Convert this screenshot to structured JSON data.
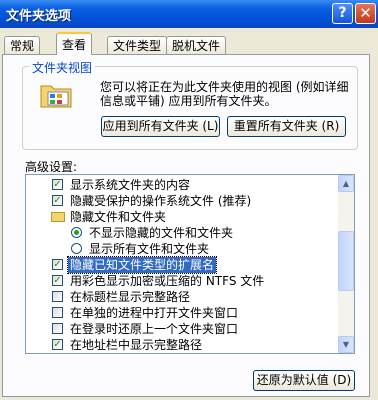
{
  "window": {
    "title": "文件夹选项"
  },
  "titlebar_buttons": {
    "help": "?",
    "close": "✕"
  },
  "tabs": [
    {
      "label": "常规"
    },
    {
      "label": "查看"
    },
    {
      "label": "文件类型"
    },
    {
      "label": "脱机文件"
    }
  ],
  "folder_views": {
    "title": "文件夹视图",
    "description": "您可以将正在为此文件夹使用的视图 (例如详细信息或平铺) 应用到所有文件夹。",
    "apply_all_button": "应用到所有文件夹 (L)",
    "reset_all_button": "重置所有文件夹 (R)"
  },
  "advanced": {
    "label": "高级设置:",
    "items": [
      {
        "type": "checkbox",
        "checked": true,
        "label": "显示系统文件夹的内容"
      },
      {
        "type": "checkbox",
        "checked": true,
        "label": "隐藏受保护的操作系统文件 (推荐)"
      },
      {
        "type": "folder",
        "label": "隐藏文件和文件夹"
      },
      {
        "type": "radio",
        "checked": true,
        "label": "不显示隐藏的文件和文件夹"
      },
      {
        "type": "radio",
        "checked": false,
        "label": "显示所有文件和文件夹"
      },
      {
        "type": "checkbox",
        "checked": true,
        "label": "隐藏已知文件类型的扩展名",
        "selected": true
      },
      {
        "type": "checkbox",
        "checked": true,
        "label": "用彩色显示加密或压缩的 NTFS 文件"
      },
      {
        "type": "checkbox",
        "checked": false,
        "label": "在标题栏显示完整路径"
      },
      {
        "type": "checkbox",
        "checked": false,
        "label": "在单独的进程中打开文件夹窗口"
      },
      {
        "type": "checkbox",
        "checked": false,
        "label": "在登录时还原上一个文件夹窗口"
      },
      {
        "type": "checkbox",
        "checked": true,
        "label": "在地址栏中显示完整路径"
      }
    ]
  },
  "restore_defaults_button": "还原为默认值 (D)",
  "colors": {
    "title_bar": "#0050d8",
    "selection": "#316ac5",
    "dialog_bg": "#ece9d8",
    "group_title": "#0046d5"
  }
}
